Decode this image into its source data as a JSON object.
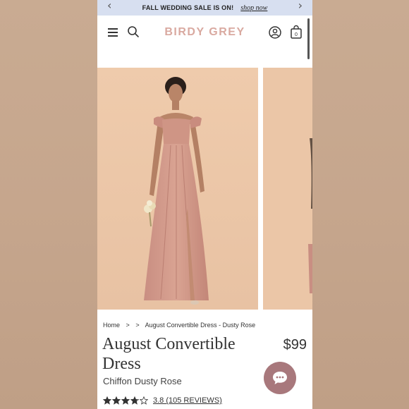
{
  "banner": {
    "text": "FALL WEDDING SALE IS ON!",
    "link": "shop now",
    "prev_icon": "chevron-left-icon",
    "next_icon": "chevron-right-icon",
    "background": "#d7dff0"
  },
  "header": {
    "logo": "BIRDY GREY",
    "logo_color": "#d9a9a0",
    "icons": [
      "menu-icon",
      "search-icon",
      "account-icon",
      "bag-icon"
    ],
    "cart_count": "0"
  },
  "gallery": {
    "images": [
      "model-wearing-dusty-rose-dress",
      "next-product-image"
    ]
  },
  "breadcrumb": {
    "home": "Home",
    "sep1": ">",
    "sep2": ">",
    "current": "August Convertible Dress - Dusty Rose"
  },
  "product": {
    "title": "August Convertible Dress",
    "price": "$99",
    "subtitle": "Chiffon Dusty Rose",
    "rating_value": 3.8,
    "rating_text": "3.8 (105 REVIEWS)"
  },
  "chat": {
    "icon": "chat-bubble-icon",
    "color": "#a8787c"
  }
}
